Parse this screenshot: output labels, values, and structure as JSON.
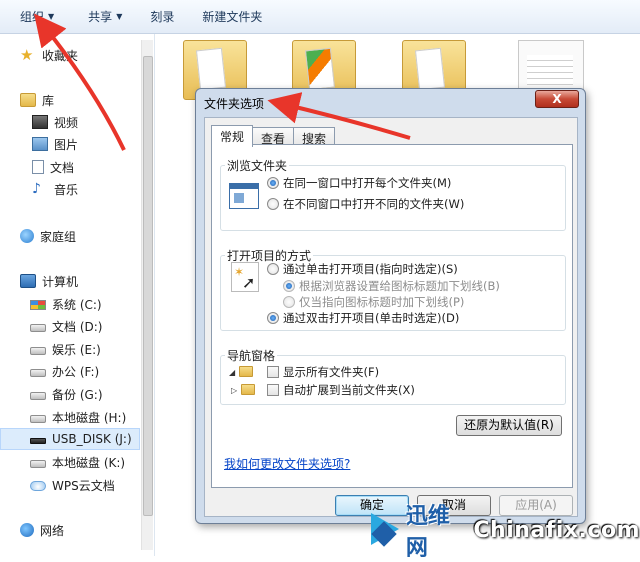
{
  "toolbar": {
    "organize": "组织",
    "share": "共享",
    "burn": "刻录",
    "new_folder": "新建文件夹"
  },
  "sidebar": {
    "favorites": "收藏夹",
    "library": "库",
    "videos": "视频",
    "pictures": "图片",
    "documents": "文档",
    "music": "音乐",
    "homegroup": "家庭组",
    "computer": "计算机",
    "drives": [
      {
        "label": "系统 (C:)",
        "icon": "system-drive-icon"
      },
      {
        "label": "文档 (D:)",
        "icon": "drive-icon"
      },
      {
        "label": "娱乐 (E:)",
        "icon": "drive-icon"
      },
      {
        "label": "办公 (F:)",
        "icon": "drive-icon"
      },
      {
        "label": "备份 (G:)",
        "icon": "drive-icon"
      },
      {
        "label": "本地磁盘 (H:)",
        "icon": "drive-icon"
      },
      {
        "label": "USB_DISK (J:)",
        "icon": "usb-drive-icon"
      },
      {
        "label": "本地磁盘 (K:)",
        "icon": "drive-icon"
      },
      {
        "label": "WPS云文档",
        "icon": "cloud-icon"
      }
    ],
    "network": "网络"
  },
  "dialog": {
    "title": "文件夹选项",
    "close": "X",
    "tabs": [
      "常规",
      "查看",
      "搜索"
    ],
    "browse_group": {
      "label": "浏览文件夹",
      "opt_same": "在同一窗口中打开每个文件夹(M)",
      "opt_new": "在不同窗口中打开不同的文件夹(W)"
    },
    "click_group": {
      "label": "打开项目的方式",
      "opt_single": "通过单击打开项目(指向时选定)(S)",
      "sub_browser": "根据浏览器设置给图标标题加下划线(B)",
      "sub_point": "仅当指向图标标题时加下划线(P)",
      "opt_double": "通过双击打开项目(单击时选定)(D)"
    },
    "nav_group": {
      "label": "导航窗格",
      "show_all": "显示所有文件夹(F)",
      "auto_expand": "自动扩展到当前文件夹(X)"
    },
    "restore_defaults": "还原为默认值(R)",
    "help_link": "我如何更改文件夹选项?",
    "ok": "确定",
    "cancel": "取消",
    "apply": "应用(A)"
  },
  "watermark": {
    "cn": "迅维网",
    "en": "Chinafix.com"
  }
}
